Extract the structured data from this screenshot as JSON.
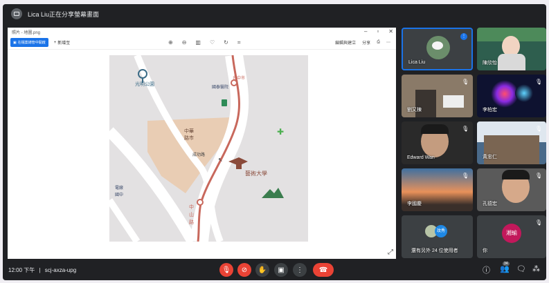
{
  "topbar": {
    "presenter_text": "Lica Liu正在分享螢幕畫面"
  },
  "screen": {
    "window_title": "照片 - 地圖.png",
    "open_button": "在檔案總管中開啟",
    "new_label": "新增至",
    "right_tools": [
      "編輯與建立",
      "分享",
      "列印",
      "更多"
    ]
  },
  "map": {
    "labels": {
      "nw_park": "光明公園",
      "ne_top": "台中市",
      "ne_sub": "國泰醫院",
      "center": "中華\n路市",
      "center2": "成功路",
      "school": "藝術大學",
      "left_bottom": "電廠\n國中",
      "bottom_vertical": "中山路"
    }
  },
  "participants": [
    {
      "name": "Lica Liu",
      "initial": ""
    },
    {
      "name": "陳欣怡",
      "initial": ""
    },
    {
      "name": "劉又棟",
      "initial": ""
    },
    {
      "name": "李柏宏",
      "initial": ""
    },
    {
      "name": "Edward Wan",
      "initial": ""
    },
    {
      "name": "黃忠仁",
      "initial": ""
    },
    {
      "name": "李國慶",
      "initial": ""
    },
    {
      "name": "孔德宏",
      "initial": ""
    },
    {
      "name": "還有另外 24 位使用者",
      "initial": "玟秀"
    },
    {
      "name": "你",
      "initial": "湘瑜"
    }
  ],
  "bottombar": {
    "time": "12:00 下午",
    "separator": "|",
    "meeting_code": "scj-axza-upg",
    "people_count": "34"
  },
  "colors": {
    "background": "#202124",
    "end_call": "#ea4335",
    "accent": "#1a73e8",
    "avatar_you": "#c2185b"
  }
}
